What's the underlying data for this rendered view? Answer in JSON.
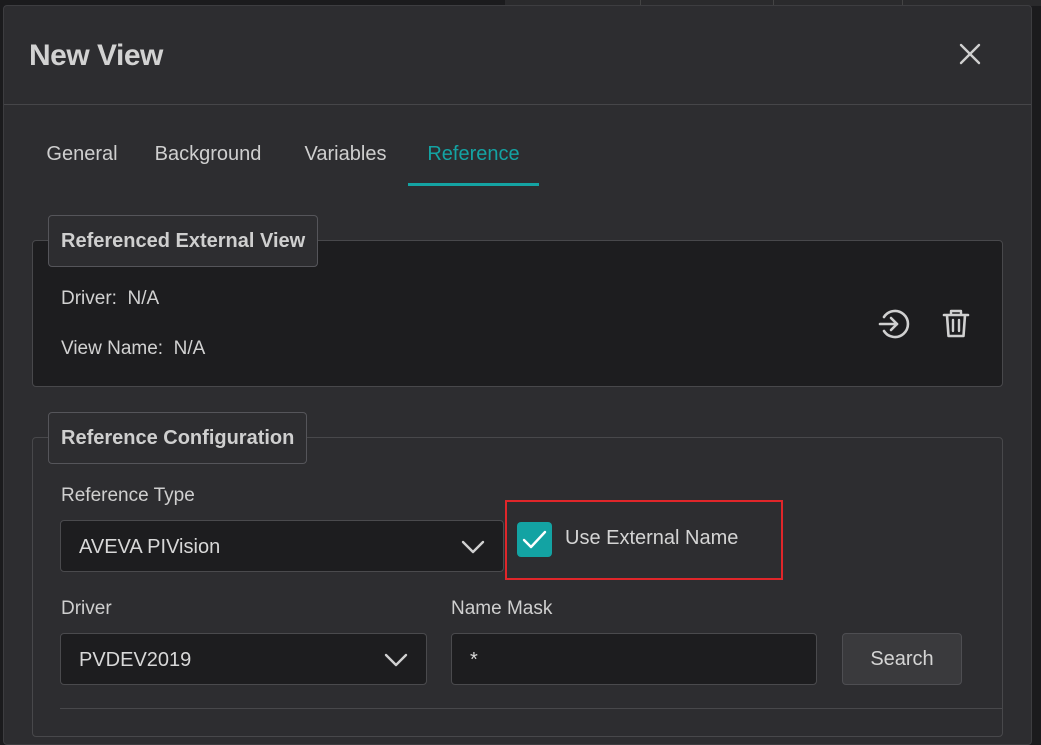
{
  "dialog": {
    "title": "New View",
    "close_icon": "close-icon"
  },
  "tabs": [
    {
      "label": "General",
      "active": false
    },
    {
      "label": "Background",
      "active": false
    },
    {
      "label": "Variables",
      "active": false
    },
    {
      "label": "Reference",
      "active": true
    }
  ],
  "referenced_external_view": {
    "legend": "Referenced External View",
    "driver_label": "Driver:",
    "driver_value": "N/A",
    "view_name_label": "View Name:",
    "view_name_value": "N/A",
    "open_icon": "open-reference-icon",
    "delete_icon": "trash-icon"
  },
  "reference_configuration": {
    "legend": "Reference Configuration",
    "reference_type_label": "Reference Type",
    "reference_type_value": "AVEVA PIVision",
    "use_external_name_label": "Use External Name",
    "use_external_name_checked": true,
    "driver_label": "Driver",
    "driver_value": "PVDEV2019",
    "name_mask_label": "Name Mask",
    "name_mask_value": "*",
    "search_button": "Search"
  },
  "colors": {
    "accent": "#14a3a3",
    "highlight": "#e0262a",
    "dialog_bg": "#2d2d30",
    "panel_bg": "#1d1d1f"
  }
}
